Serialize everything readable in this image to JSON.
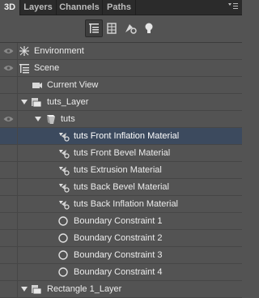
{
  "tabs": [
    {
      "label": "3D",
      "active": true
    },
    {
      "label": "Layers",
      "active": false
    },
    {
      "label": "Channels",
      "active": false
    },
    {
      "label": "Paths",
      "active": false
    }
  ],
  "toolbar": {
    "tools": [
      "whole-scene-filter-icon",
      "meshes-filter-icon",
      "materials-filter-icon",
      "lights-filter-icon"
    ]
  },
  "layers": [
    {
      "label": "Environment",
      "icon": "environment-icon"
    },
    {
      "label": "Scene",
      "icon": "scene-icon"
    },
    {
      "label": "Current View",
      "icon": "camera-icon"
    },
    {
      "label": "tuts_Layer",
      "icon": "layer-icon",
      "expanded": true
    },
    {
      "label": "tuts",
      "icon": "mesh-icon",
      "expanded": true
    },
    {
      "label": "tuts Front Inflation Material",
      "icon": "material-icon",
      "selected": true
    },
    {
      "label": "tuts Front Bevel Material",
      "icon": "material-icon"
    },
    {
      "label": "tuts Extrusion Material",
      "icon": "material-icon"
    },
    {
      "label": "tuts Back Bevel Material",
      "icon": "material-icon"
    },
    {
      "label": "tuts Back Inflation Material",
      "icon": "material-icon"
    },
    {
      "label": "Boundary Constraint 1",
      "icon": "constraint-icon"
    },
    {
      "label": "Boundary Constraint 2",
      "icon": "constraint-icon"
    },
    {
      "label": "Boundary Constraint 3",
      "icon": "constraint-icon"
    },
    {
      "label": "Boundary Constraint 4",
      "icon": "constraint-icon"
    },
    {
      "label": "Rectangle 1_Layer",
      "icon": "layer-icon",
      "expanded": true
    }
  ],
  "colors": {
    "panel": "#535353",
    "tabbar": "#2b2b2b",
    "selection": "#3c4a5e"
  }
}
